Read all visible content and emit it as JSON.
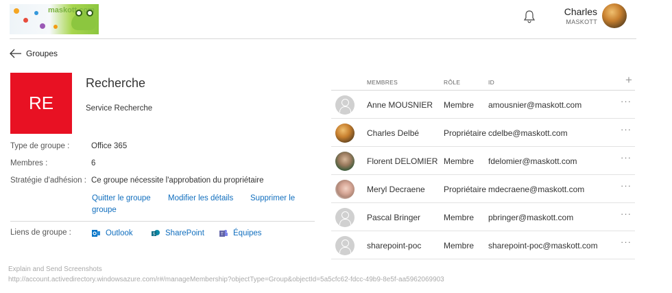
{
  "header": {
    "logo_text": "maskott.com",
    "user_name": "Charles",
    "user_org": "MASKOTT"
  },
  "nav": {
    "back_label": "Groupes"
  },
  "group": {
    "tile_initials": "RE",
    "tile_color": "#e81123",
    "title": "Recherche",
    "description": "Service Recherche",
    "properties": [
      {
        "label": "Type de groupe :",
        "value": "Office 365"
      },
      {
        "label": "Membres :",
        "value": "6"
      },
      {
        "label": "Stratégie d'adhésion :",
        "value": "Ce groupe nécessite l'approbation du propriétaire"
      }
    ],
    "actions": {
      "leave": "Quitter le groupe",
      "edit": "Modifier les détails",
      "delete_line1": "Supprimer le",
      "delete_line2": "groupe"
    },
    "links_label": "Liens de groupe :",
    "links": {
      "outlook": "Outlook",
      "sharepoint": "SharePoint",
      "teams": "Équipes"
    }
  },
  "members_table": {
    "headers": {
      "members": "MEMBRES",
      "role": "RÔLE",
      "id": "ID"
    },
    "add_symbol": "+",
    "more_symbol": "···",
    "rows": [
      {
        "name": "Anne MOUSNIER",
        "role": "Membre",
        "id": "amousnier@maskott.com",
        "avatar": "generic"
      },
      {
        "name": "Charles Delbé",
        "role": "Propriétaire",
        "id": "cdelbe@maskott.com",
        "avatar": "photo1"
      },
      {
        "name": "Florent DELOMIER",
        "role": "Membre",
        "id": "fdelomier@maskott.com",
        "avatar": "photo2"
      },
      {
        "name": "Meryl Decraene",
        "role": "Propriétaire",
        "id": "mdecraene@maskott.com",
        "avatar": "photo3"
      },
      {
        "name": "Pascal Bringer",
        "role": "Membre",
        "id": "pbringer@maskott.com",
        "avatar": "generic"
      },
      {
        "name": "sharepoint-poc",
        "role": "Membre",
        "id": "sharepoint-poc@maskott.com",
        "avatar": "generic"
      }
    ]
  },
  "footer": {
    "line1": "Explain and Send Screenshots",
    "line2": "http://account.activedirectory.windowsazure.com/r#/manageMembership?objectType=Group&objectId=5a5cfc62-fdcc-49b9-8e5f-aa5962069903"
  },
  "colors": {
    "link": "#106ebe",
    "tile": "#e81123",
    "outlook": "#0072c6",
    "sharepoint": "#0b6a84",
    "teams": "#6264a7"
  }
}
